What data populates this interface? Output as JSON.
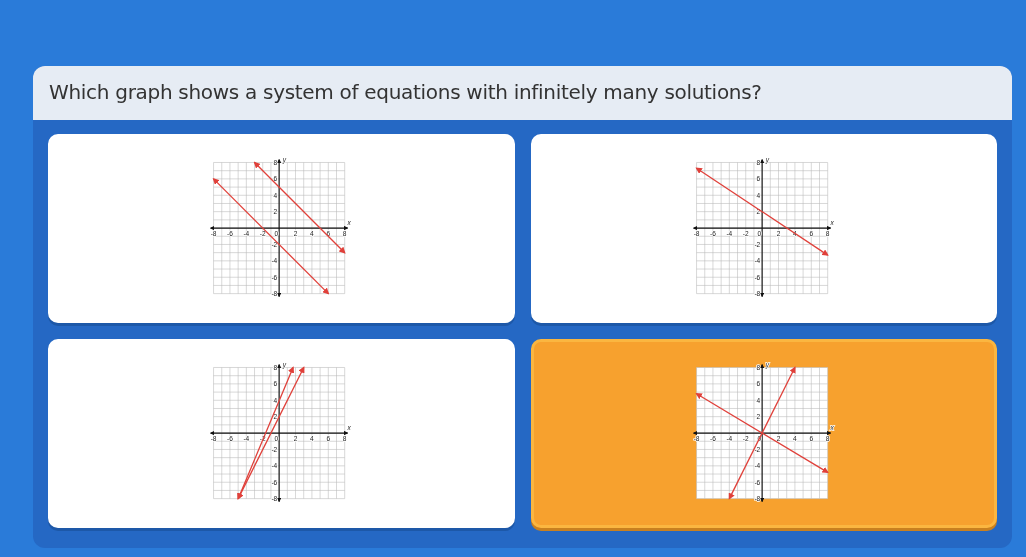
{
  "question": "Which graph shows a system of equations with infinitely many solutions?",
  "options": [
    {
      "selected": false,
      "chart_data": {
        "type": "line",
        "xlabel": "x",
        "ylabel": "y",
        "xlim": [
          -8,
          8
        ],
        "ylim": [
          -8,
          8
        ],
        "xticks": [
          -8,
          -6,
          -4,
          -2,
          0,
          2,
          4,
          6,
          8
        ],
        "yticks": [
          -8,
          -6,
          -4,
          -2,
          2,
          4,
          6,
          8
        ],
        "series": [
          {
            "color": "#e0403a",
            "x": [
              -8,
              6
            ],
            "values": [
              6,
              -8
            ]
          },
          {
            "color": "#e0403a",
            "x": [
              -3,
              8
            ],
            "values": [
              8,
              -3
            ]
          }
        ],
        "grid": true
      }
    },
    {
      "selected": false,
      "chart_data": {
        "type": "line",
        "xlabel": "x",
        "ylabel": "y",
        "xlim": [
          -8,
          8
        ],
        "ylim": [
          -8,
          8
        ],
        "xticks": [
          -8,
          -6,
          -4,
          -2,
          0,
          2,
          4,
          6,
          8
        ],
        "yticks": [
          -8,
          -6,
          -4,
          -2,
          2,
          4,
          6,
          8
        ],
        "series": [
          {
            "color": "#e0403a",
            "x": [
              -8,
              8
            ],
            "values": [
              7.3,
              -3.3
            ]
          }
        ],
        "grid": true
      }
    },
    {
      "selected": false,
      "chart_data": {
        "type": "line",
        "xlabel": "x",
        "ylabel": "y",
        "xlim": [
          -8,
          8
        ],
        "ylim": [
          -8,
          8
        ],
        "xticks": [
          -8,
          -6,
          -4,
          -2,
          0,
          2,
          4,
          6,
          8
        ],
        "yticks": [
          -8,
          -6,
          -4,
          -2,
          2,
          4,
          6,
          8
        ],
        "series": [
          {
            "color": "#e0403a",
            "x": [
              -5,
              1.7
            ],
            "values": [
              -8,
              8
            ]
          },
          {
            "color": "#e0403a",
            "x": [
              -5,
              3
            ],
            "values": [
              -8,
              8
            ]
          }
        ],
        "grid": true
      }
    },
    {
      "selected": true,
      "chart_data": {
        "type": "line",
        "xlabel": "x",
        "ylabel": "y",
        "xlim": [
          -8,
          8
        ],
        "ylim": [
          -8,
          8
        ],
        "xticks": [
          -8,
          -6,
          -4,
          -2,
          0,
          2,
          4,
          6,
          8
        ],
        "yticks": [
          -8,
          -6,
          -4,
          -2,
          2,
          4,
          6,
          8
        ],
        "series": [
          {
            "color": "#e0403a",
            "x": [
              -4,
              4
            ],
            "values": [
              -8,
              8
            ]
          },
          {
            "color": "#e0403a",
            "x": [
              -8,
              8
            ],
            "values": [
              4.8,
              -4.8
            ]
          }
        ],
        "grid": true
      }
    }
  ]
}
